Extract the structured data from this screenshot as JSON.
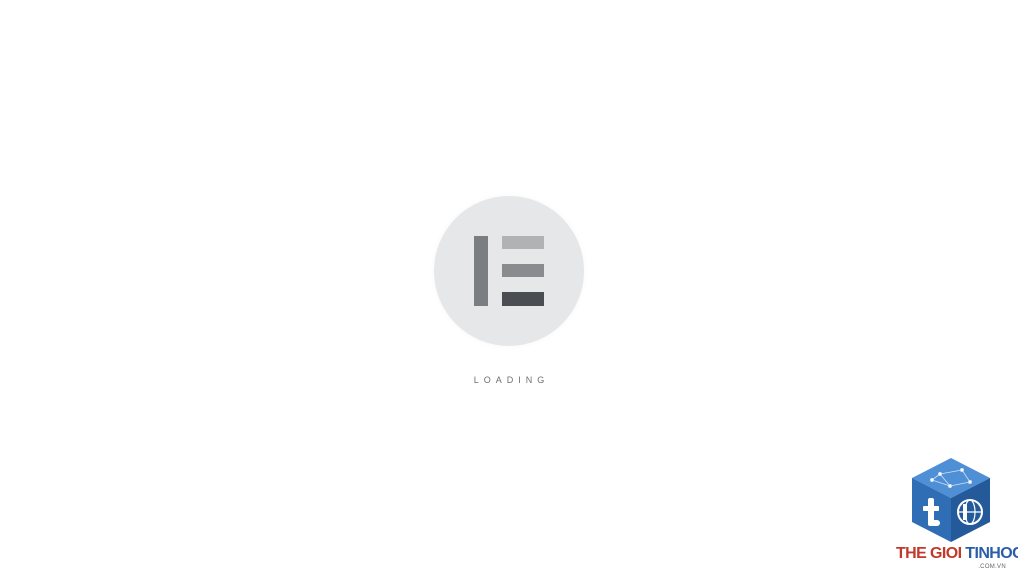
{
  "loader": {
    "logo_icon": "elementor-logo-icon",
    "text": "LOADING",
    "colors": {
      "circle": "#e6e7e8",
      "bar_vertical": "#7a7d82",
      "bar_top": "#b1b2b4",
      "bar_mid": "#8a8b8f",
      "bar_bottom": "#4a4d52"
    }
  },
  "watermark": {
    "icon": "thegioitinhoc-cube-logo",
    "title_part1": "THE GIOI",
    "title_part2": "TINHOC",
    "subtitle": ".COM.VN",
    "colors": {
      "cube_blue": "#2f6db5",
      "title_red": "#c0392b",
      "title_blue": "#2a5ea8"
    }
  }
}
